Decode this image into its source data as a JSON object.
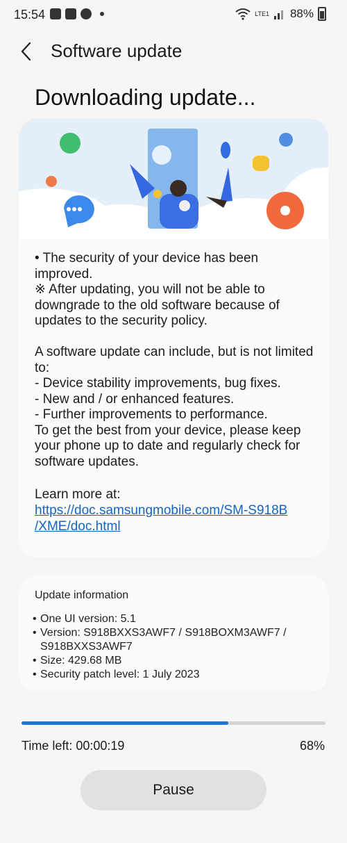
{
  "status_bar": {
    "time": "15:54",
    "network": "LTE1",
    "battery": "88%"
  },
  "header": {
    "title": "Software update"
  },
  "main": {
    "heading": "Downloading update..."
  },
  "release_notes": {
    "text": "• The security of your device has been improved.\n※ After updating, you will not be able to downgrade to the old software because of updates to the security policy.\n\nA software update can include, but is not limited to:\n - Device stability improvements, bug fixes.\n - New and / or enhanced features.\n - Further improvements to performance.\nTo get the best from your device, please keep your phone up to date and regularly check for software updates.",
    "learn_more_label": "Learn more at:",
    "link": "https://doc.samsungmobile.com/SM-S918B\n/XME/doc.html"
  },
  "update_info": {
    "title": "Update information",
    "items": [
      "One UI version: 5.1",
      "Version: S918BXXS3AWF7 / S918BOXM3AWF7 / S918BXXS3AWF7",
      "Size: 429.68 MB",
      "Security patch level: 1 July 2023"
    ]
  },
  "download": {
    "progress": 0.68,
    "time_left": "Time left: 00:00:19",
    "percent": "68%"
  },
  "buttons": {
    "pause": "Pause"
  },
  "colors": {
    "accent": "#1f74e0",
    "link": "#1565c0",
    "background": "#f6f6f6"
  }
}
